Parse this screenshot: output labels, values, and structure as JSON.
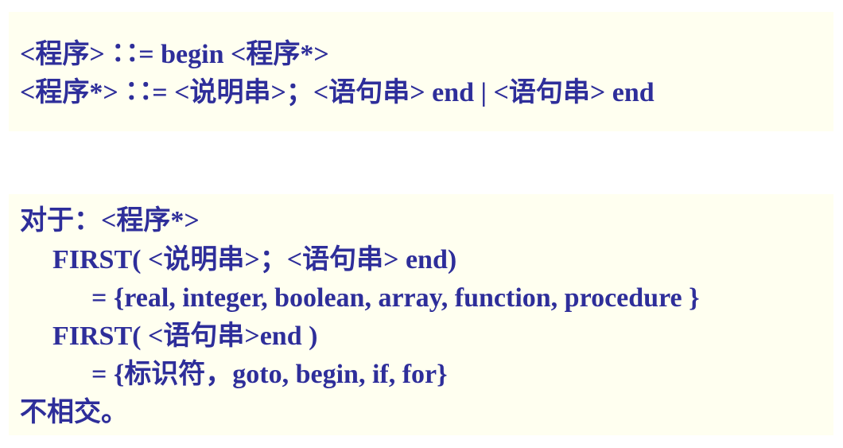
{
  "grammar_box": {
    "lines": [
      "<程序> ∷= begin <程序*>",
      "<程序*> ∷= <说明串>；<语句串> end | <语句串> end"
    ]
  },
  "first_box": {
    "lines": [
      "对于：<程序*>",
      "FIRST( <说明串>；<语句串> end)",
      "= {real, integer, boolean, array, function, procedure }",
      "FIRST( <语句串>end )",
      "= {标识符，goto, begin, if, for}",
      "不相交。"
    ]
  }
}
